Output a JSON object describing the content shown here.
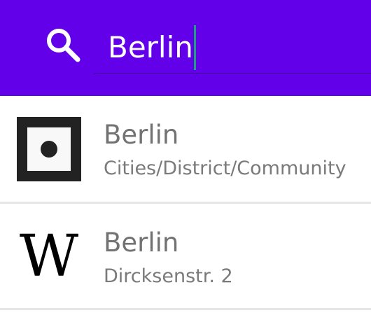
{
  "search": {
    "value": "Berlin",
    "icon": "search-icon"
  },
  "results": [
    {
      "title": "Berlin",
      "subtitle": "Cities/District/Community",
      "icon": "location-square-icon"
    },
    {
      "title": "Berlin",
      "subtitle": "Dircksenstr. 2",
      "icon": "wikipedia-icon",
      "icon_glyph": "W"
    }
  ],
  "colors": {
    "header": "#6200ea",
    "caret": "#1aa37a",
    "title": "#727272",
    "subtitle": "#7a7a7a"
  }
}
